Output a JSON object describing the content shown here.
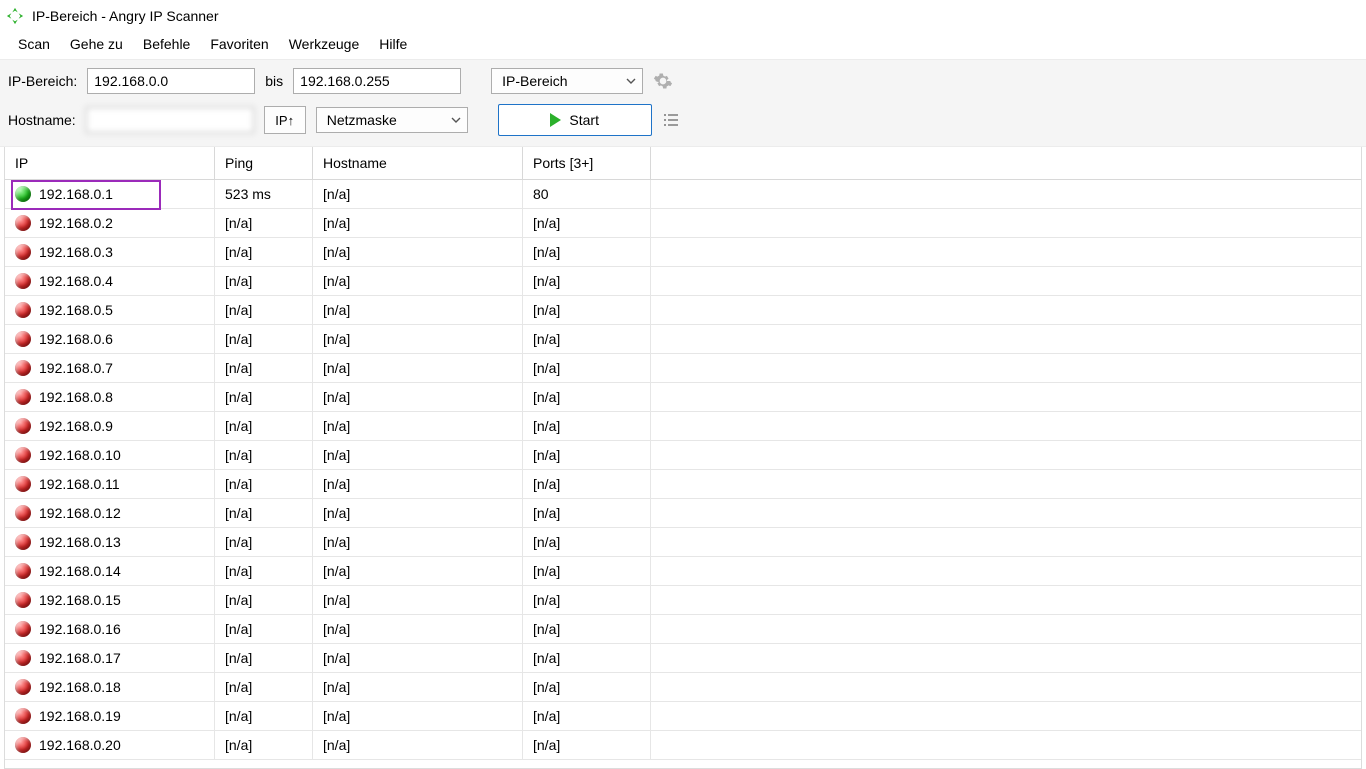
{
  "title": "IP-Bereich - Angry IP Scanner",
  "menu": [
    "Scan",
    "Gehe zu",
    "Befehle",
    "Favoriten",
    "Werkzeuge",
    "Hilfe"
  ],
  "toolbar": {
    "range_label": "IP-Bereich:",
    "ip_start": "192.168.0.0",
    "range_sep": "bis",
    "ip_end": "192.168.0.255",
    "mode_value": "IP-Bereich",
    "hostname_label": "Hostname:",
    "hostname_value": "",
    "ip_up_label": "IP↑",
    "netmask_value": "Netzmaske",
    "start_label": "Start"
  },
  "columns": {
    "ip": "IP",
    "ping": "Ping",
    "hostname": "Hostname",
    "ports": "Ports [3+]"
  },
  "rows": [
    {
      "status": "green",
      "ip": "192.168.0.1",
      "ping": "523 ms",
      "hostname": "[n/a]",
      "ports": "80",
      "highlight": true
    },
    {
      "status": "red",
      "ip": "192.168.0.2",
      "ping": "[n/a]",
      "hostname": "[n/a]",
      "ports": "[n/a]"
    },
    {
      "status": "red",
      "ip": "192.168.0.3",
      "ping": "[n/a]",
      "hostname": "[n/a]",
      "ports": "[n/a]"
    },
    {
      "status": "red",
      "ip": "192.168.0.4",
      "ping": "[n/a]",
      "hostname": "[n/a]",
      "ports": "[n/a]"
    },
    {
      "status": "red",
      "ip": "192.168.0.5",
      "ping": "[n/a]",
      "hostname": "[n/a]",
      "ports": "[n/a]"
    },
    {
      "status": "red",
      "ip": "192.168.0.6",
      "ping": "[n/a]",
      "hostname": "[n/a]",
      "ports": "[n/a]"
    },
    {
      "status": "red",
      "ip": "192.168.0.7",
      "ping": "[n/a]",
      "hostname": "[n/a]",
      "ports": "[n/a]"
    },
    {
      "status": "red",
      "ip": "192.168.0.8",
      "ping": "[n/a]",
      "hostname": "[n/a]",
      "ports": "[n/a]"
    },
    {
      "status": "red",
      "ip": "192.168.0.9",
      "ping": "[n/a]",
      "hostname": "[n/a]",
      "ports": "[n/a]"
    },
    {
      "status": "red",
      "ip": "192.168.0.10",
      "ping": "[n/a]",
      "hostname": "[n/a]",
      "ports": "[n/a]"
    },
    {
      "status": "red",
      "ip": "192.168.0.11",
      "ping": "[n/a]",
      "hostname": "[n/a]",
      "ports": "[n/a]"
    },
    {
      "status": "red",
      "ip": "192.168.0.12",
      "ping": "[n/a]",
      "hostname": "[n/a]",
      "ports": "[n/a]"
    },
    {
      "status": "red",
      "ip": "192.168.0.13",
      "ping": "[n/a]",
      "hostname": "[n/a]",
      "ports": "[n/a]"
    },
    {
      "status": "red",
      "ip": "192.168.0.14",
      "ping": "[n/a]",
      "hostname": "[n/a]",
      "ports": "[n/a]"
    },
    {
      "status": "red",
      "ip": "192.168.0.15",
      "ping": "[n/a]",
      "hostname": "[n/a]",
      "ports": "[n/a]"
    },
    {
      "status": "red",
      "ip": "192.168.0.16",
      "ping": "[n/a]",
      "hostname": "[n/a]",
      "ports": "[n/a]"
    },
    {
      "status": "red",
      "ip": "192.168.0.17",
      "ping": "[n/a]",
      "hostname": "[n/a]",
      "ports": "[n/a]"
    },
    {
      "status": "red",
      "ip": "192.168.0.18",
      "ping": "[n/a]",
      "hostname": "[n/a]",
      "ports": "[n/a]"
    },
    {
      "status": "red",
      "ip": "192.168.0.19",
      "ping": "[n/a]",
      "hostname": "[n/a]",
      "ports": "[n/a]"
    },
    {
      "status": "red",
      "ip": "192.168.0.20",
      "ping": "[n/a]",
      "hostname": "[n/a]",
      "ports": "[n/a]"
    }
  ]
}
